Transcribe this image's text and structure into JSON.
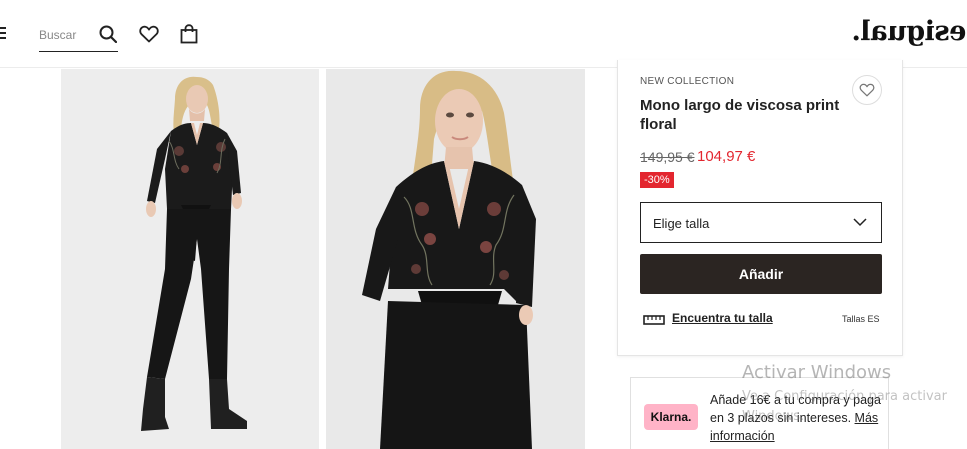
{
  "header": {
    "search_placeholder": "Buscar",
    "logo": "Desigual."
  },
  "product": {
    "collection_label": "NEW COLLECTION",
    "title": "Mono largo de viscosa print floral",
    "old_price": "149,95 €",
    "new_price": "104,97 €",
    "discount": "-30%",
    "size_select_label": "Elige talla",
    "add_button": "Añadir",
    "find_size_link": "Encuentra tu talla",
    "size_system": "Tallas ES"
  },
  "klarna": {
    "badge": "Klarna.",
    "text": "Añade 16€ a tu compra y paga en 3 plazos sin intereses.",
    "link": "Más información"
  },
  "watermark": {
    "title": "Activar Windows",
    "subtitle": "Ve a Configuración para activar Windows."
  },
  "colors": {
    "sale_red": "#e3262f",
    "button_dark": "#2b2522",
    "klarna_pink": "#ffb3c7"
  },
  "icons": [
    "menu-icon",
    "search-icon",
    "heart-icon",
    "bag-icon",
    "chevron-down-icon",
    "ruler-icon"
  ]
}
